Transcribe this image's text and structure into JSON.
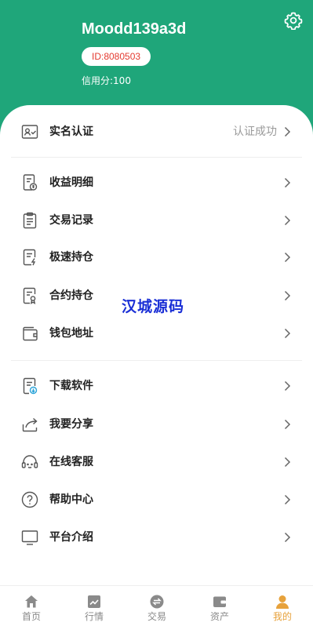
{
  "profile": {
    "username": "Moodd139a3d",
    "id_label": "ID:8080503",
    "credit_label": "信用分:100"
  },
  "verify": {
    "label": "实名认证",
    "status": "认证成功"
  },
  "menu_group_1": [
    {
      "label": "收益明细",
      "icon": "income-detail-icon"
    },
    {
      "label": "交易记录",
      "icon": "trade-record-icon"
    },
    {
      "label": "极速持仓",
      "icon": "fast-position-icon"
    },
    {
      "label": "合约持仓",
      "icon": "contract-position-icon"
    },
    {
      "label": "钱包地址",
      "icon": "wallet-icon"
    }
  ],
  "menu_group_2": [
    {
      "label": "下载软件",
      "icon": "download-icon"
    },
    {
      "label": "我要分享",
      "icon": "share-icon"
    },
    {
      "label": "在线客服",
      "icon": "headset-icon"
    },
    {
      "label": "帮助中心",
      "icon": "help-icon"
    },
    {
      "label": "平台介绍",
      "icon": "monitor-icon"
    }
  ],
  "watermark": "汉城源码",
  "tabbar": [
    {
      "label": "首页",
      "icon": "home-icon",
      "active": false
    },
    {
      "label": "行情",
      "icon": "chart-icon",
      "active": false
    },
    {
      "label": "交易",
      "icon": "exchange-icon",
      "active": false
    },
    {
      "label": "资产",
      "icon": "wallet-tab-icon",
      "active": false
    },
    {
      "label": "我的",
      "icon": "user-icon",
      "active": true
    }
  ],
  "colors": {
    "brand": "#1fa67a",
    "id_text": "#e4392f",
    "active_tab": "#e7a23c",
    "inactive_tab": "#8a8a8a",
    "watermark": "#1a2fd6"
  }
}
